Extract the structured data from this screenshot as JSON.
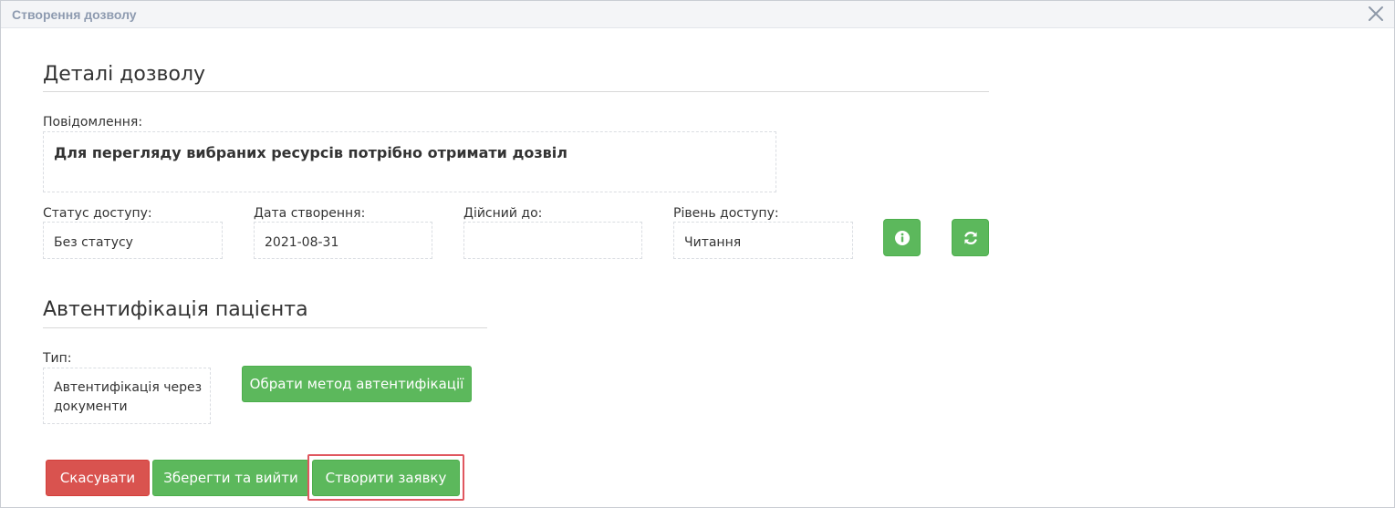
{
  "window": {
    "title": "Створення дозволу"
  },
  "details": {
    "title": "Деталі дозволу",
    "message_label": "Повідомлення:",
    "message_value": "Для перегляду вибраних ресурсів потрібно отримати дозвіл",
    "status_label": "Статус доступу:",
    "status_value": "Без статусу",
    "created_label": "Дата створення:",
    "created_value": "2021-08-31",
    "valid_until_label": "Дійсний до:",
    "valid_until_value": "",
    "level_label": "Рівень доступу:",
    "level_value": "Читання"
  },
  "auth": {
    "title": "Автентифікація пацієнта",
    "type_label": "Тип:",
    "type_value": "Автентифікація через документи",
    "choose_method_label": "Обрати метод автентифікації"
  },
  "footer": {
    "cancel_label": "Скасувати",
    "save_exit_label": "Зберегти та вийти",
    "create_request_label": "Створити заявку"
  },
  "colors": {
    "primary_green": "#5cb85c",
    "danger_red": "#d9534f",
    "highlight_red": "#e0575f"
  },
  "icons": {
    "close": "close-icon",
    "info": "info-icon",
    "refresh": "refresh-icon"
  }
}
